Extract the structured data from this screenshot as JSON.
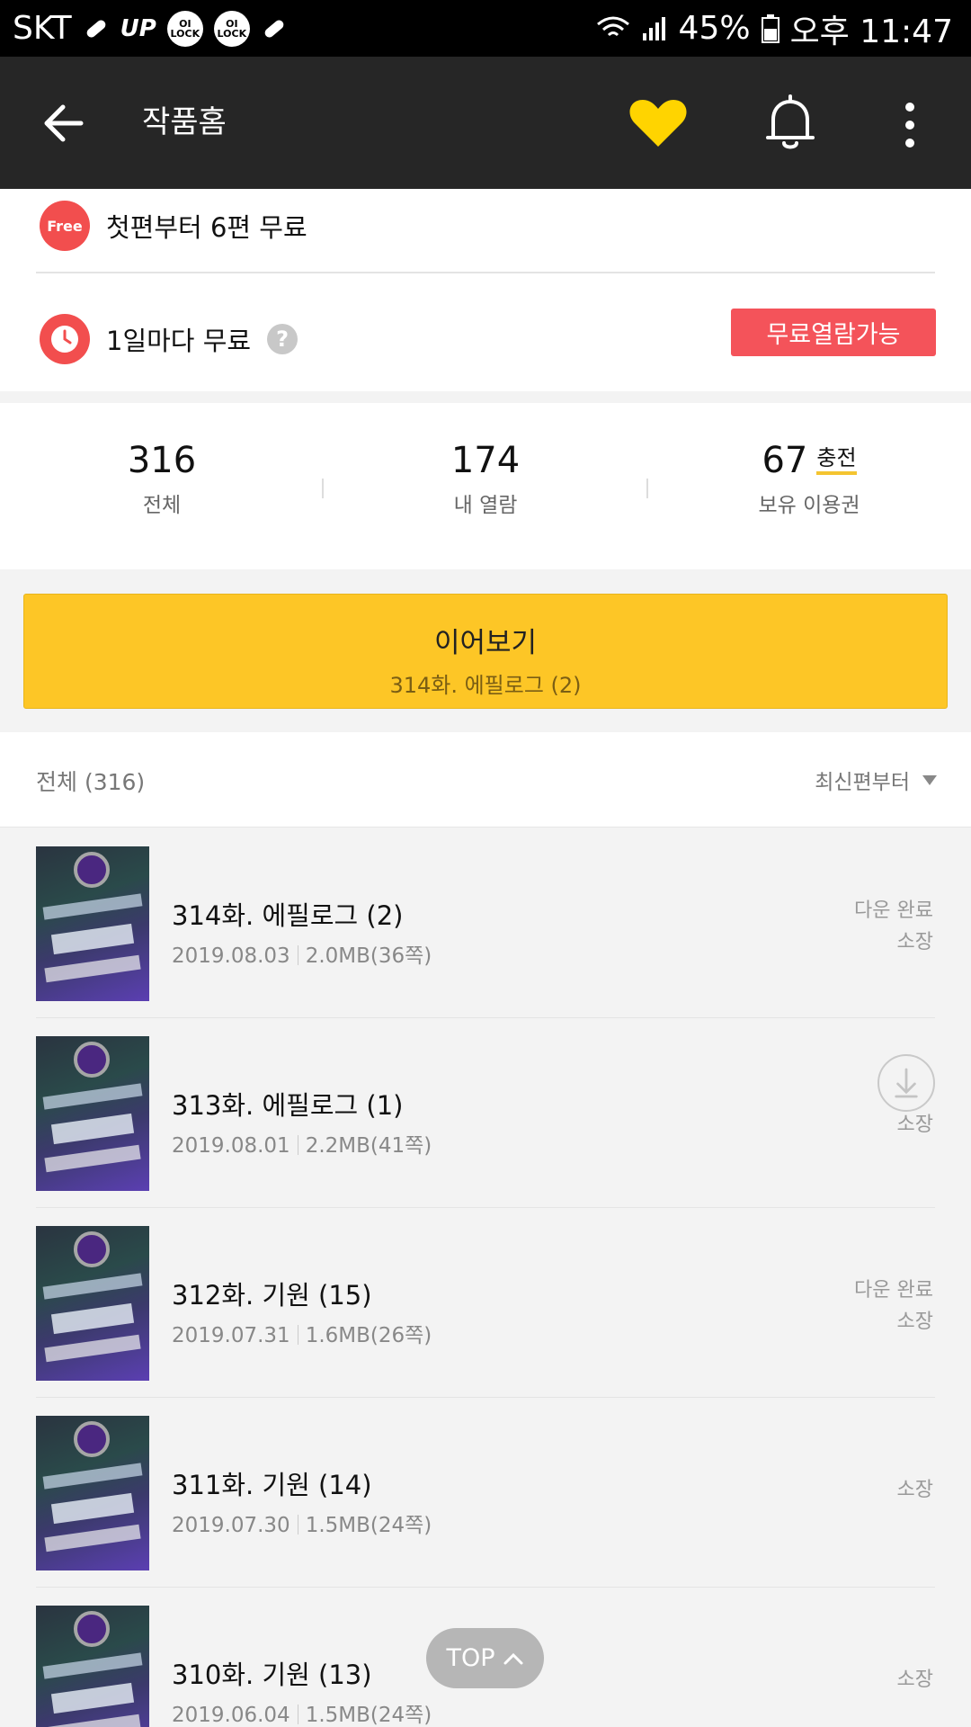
{
  "status_bar": {
    "carrier": "SKT",
    "up_label": "UP",
    "lock_chip_1": "OI LOCK",
    "lock_chip_2": "OI LOCK",
    "battery_percent": "45%",
    "time": "오후 11:47"
  },
  "app_bar": {
    "title": "작품홈",
    "icons": [
      "back-arrow-icon",
      "heart-icon",
      "bell-icon",
      "more-vertical-icon"
    ],
    "heart_color": "#ffd400"
  },
  "free_info": {
    "badge_text": "Free",
    "first_free_text": "첫편부터 6편 무료",
    "daily_free_text": "1일마다 무료",
    "help_symbol": "?",
    "open_button_label": "무료열람가능"
  },
  "stats": {
    "total_value": "316",
    "total_label": "전체",
    "my_read_value": "174",
    "my_read_label": "내 열람",
    "tickets_value": "67",
    "charge_label": "충전",
    "tickets_label": "보유 이용권"
  },
  "continue": {
    "title": "이어보기",
    "subtitle": "314화. 에필로그 (2)",
    "color": "#fdc626"
  },
  "list_header": {
    "count_label": "전체 (316)",
    "sort_label": "최신편부터"
  },
  "episodes": [
    {
      "title": "314화. 에필로그 (2)",
      "date": "2019.08.03",
      "size": "2.0MB(36쪽)",
      "download": "다운 완료",
      "owned": "소장"
    },
    {
      "title": "313화. 에필로그 (1)",
      "date": "2019.08.01",
      "size": "2.2MB(41쪽)",
      "download": "",
      "owned": "소장"
    },
    {
      "title": "312화. 기원 (15)",
      "date": "2019.07.31",
      "size": "1.6MB(26쪽)",
      "download": "다운 완료",
      "owned": "소장"
    },
    {
      "title": "311화. 기원 (14)",
      "date": "2019.07.30",
      "size": "1.5MB(24쪽)",
      "download": "",
      "owned": "소장"
    },
    {
      "title": "310화. 기원 (13)",
      "date": "2019.06.04",
      "size": "1.5MB(24쪽)",
      "download": "",
      "owned": "소장"
    }
  ],
  "top_button": {
    "label": "TOP"
  },
  "colors": {
    "accent_red": "#f24e4e",
    "accent_yellow": "#fdc626",
    "appbar_bg": "#262626"
  }
}
